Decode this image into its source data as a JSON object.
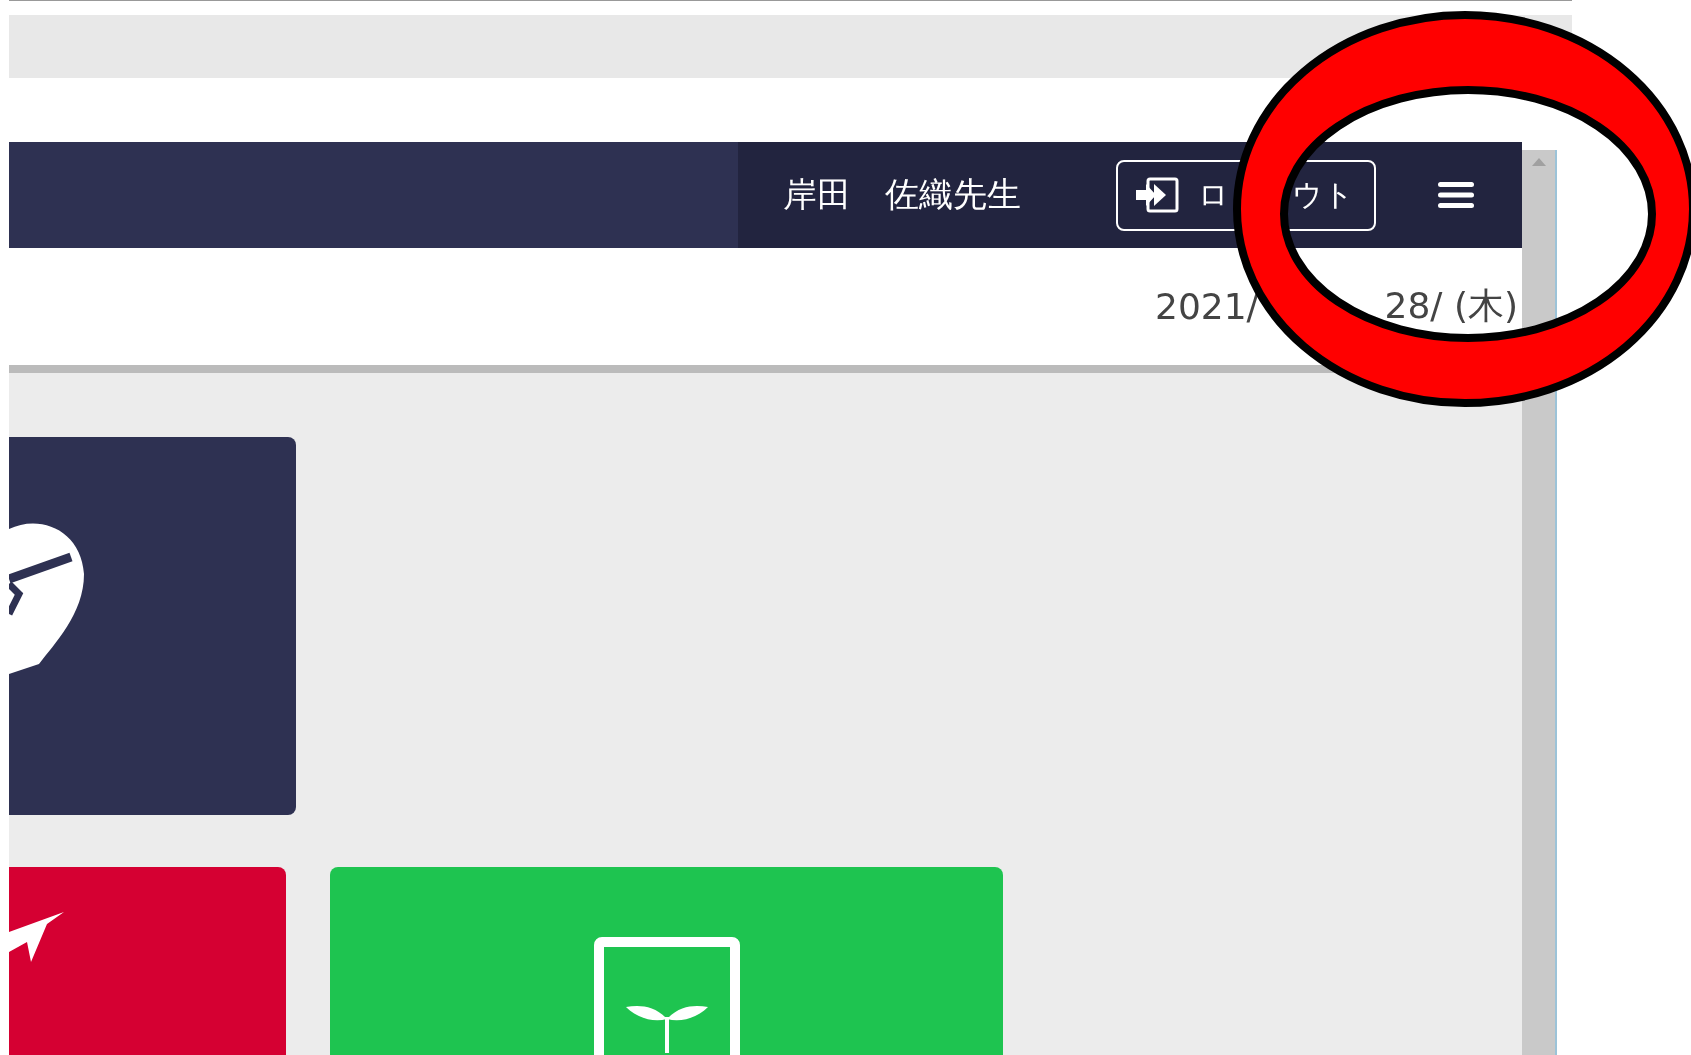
{
  "header": {
    "user_name": "岸田　佐織先生",
    "logout_button": {
      "label_parts": [
        "ロ",
        "ウト"
      ]
    }
  },
  "date_parts": [
    "2021/",
    "28/ (木)"
  ],
  "tiles": [
    {
      "kind": "shield",
      "color": "#2e3152"
    },
    {
      "kind": "arrow",
      "color": "#d50032"
    },
    {
      "kind": "sprout",
      "color": "#1ec450"
    }
  ],
  "annotation": {
    "kind": "ellipse"
  }
}
